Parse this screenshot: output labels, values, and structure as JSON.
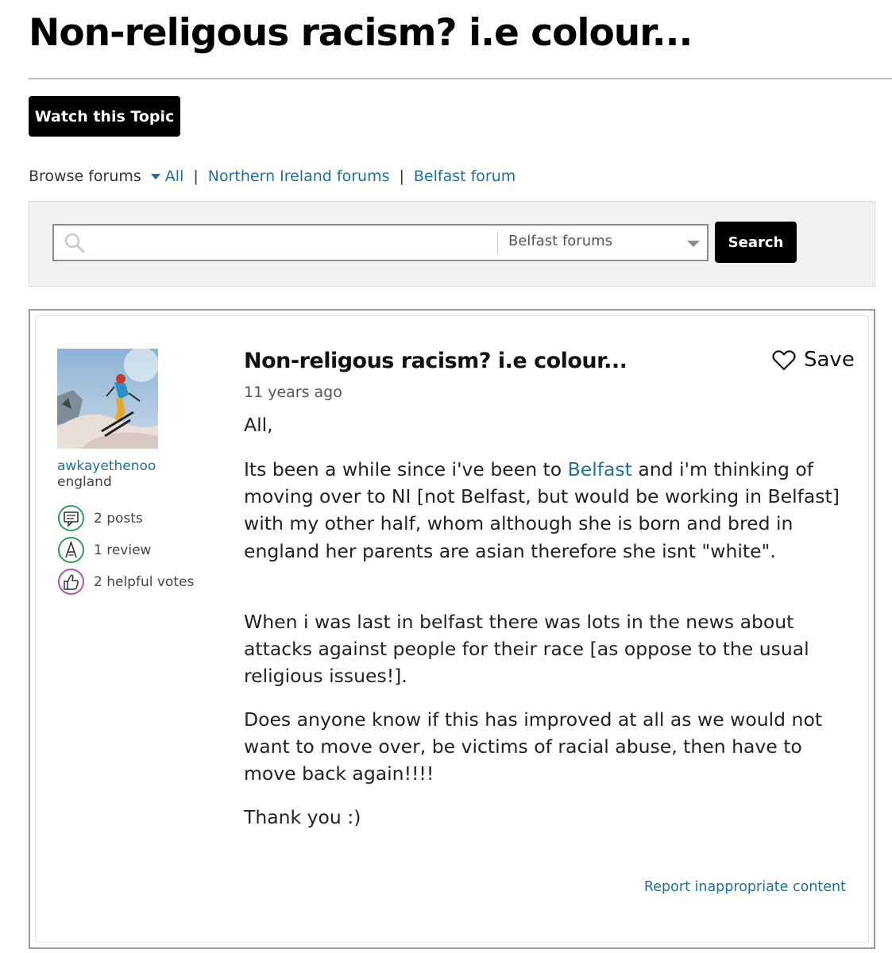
{
  "page": {
    "title": "Non-religous racism? i.e colour..."
  },
  "toolbar": {
    "watch_label": "Watch this Topic"
  },
  "browse": {
    "label": "Browse forums",
    "all_label": "All",
    "separator": "|",
    "links": [
      "Northern Ireland forums",
      "Belfast forum"
    ]
  },
  "search": {
    "value": "",
    "placeholder": "",
    "scope": "Belfast forums",
    "button_label": "Search"
  },
  "post": {
    "author": {
      "username": "awkayethenoo",
      "location": "england",
      "stats": [
        {
          "icon": "posts-icon",
          "label": "2 posts"
        },
        {
          "icon": "review-icon",
          "label": "1 review"
        },
        {
          "icon": "helpful-votes-icon",
          "label": "2 helpful votes"
        }
      ]
    },
    "title": "Non-religous racism? i.e colour...",
    "save_label": "Save",
    "time": "11 years ago",
    "body": {
      "p1": "All,",
      "p2_before": "Its been a while since i've been to ",
      "p2_link": "Belfast",
      "p2_after": " and i'm thinking of moving over to NI [not Belfast, but would be working in Belfast] with my other half, whom although she is born and bred in england her parents are asian therefore she isnt \"white\".",
      "p3": "When i was last in belfast there was lots in the news about attacks against people for their race [as oppose to the usual religious issues!].",
      "p4": "Does anyone know if this has improved at all as we would not want to move over, be victims of racial abuse, then have to move back again!!!!",
      "p5": "Thank you :)"
    },
    "report_label": "Report inappropriate content"
  },
  "colors": {
    "link": "#1f6f9e",
    "button_bg": "#000000",
    "posts_icon": "#2e9e57",
    "review_icon": "#2e9e57",
    "helpful_icon": "#b34fae"
  }
}
